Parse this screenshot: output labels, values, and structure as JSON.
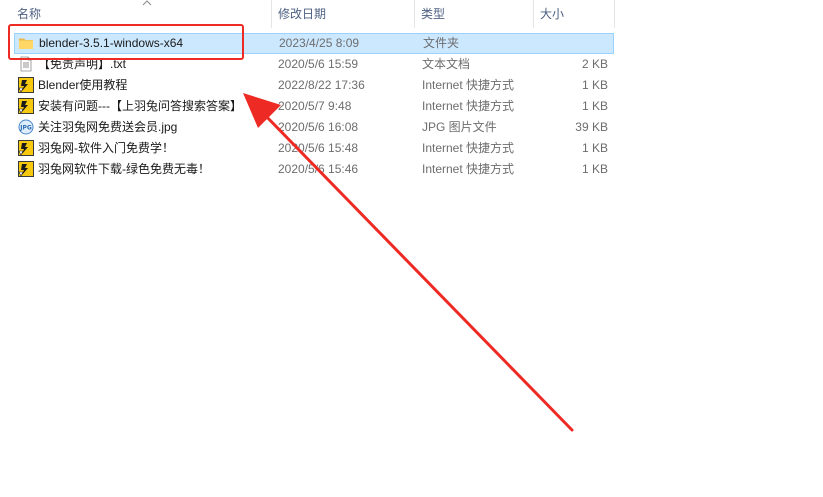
{
  "columns": {
    "name": "名称",
    "date": "修改日期",
    "type": "类型",
    "size": "大小"
  },
  "files": [
    {
      "name": "blender-3.5.1-windows-x64",
      "date": "2023/4/25 8:09",
      "type": "文件夹",
      "size": "",
      "icon": "folder-icon",
      "selected": true
    },
    {
      "name": "【免责声明】.txt",
      "date": "2020/5/6 15:59",
      "type": "文本文档",
      "size": "2 KB",
      "icon": "text-file-icon",
      "selected": false
    },
    {
      "name": "Blender使用教程",
      "date": "2022/8/22 17:36",
      "type": "Internet 快捷方式",
      "size": "1 KB",
      "icon": "internet-shortcut-icon",
      "selected": false
    },
    {
      "name": "安装有问题---【上羽兔问答搜索答案】",
      "date": "2020/5/7 9:48",
      "type": "Internet 快捷方式",
      "size": "1 KB",
      "icon": "internet-shortcut-icon",
      "selected": false
    },
    {
      "name": "关注羽兔网免费送会员.jpg",
      "date": "2020/5/6 16:08",
      "type": "JPG 图片文件",
      "size": "39 KB",
      "icon": "jpg-image-icon",
      "selected": false
    },
    {
      "name": "羽兔网-软件入门免费学！",
      "date": "2020/5/6 15:48",
      "type": "Internet 快捷方式",
      "size": "1 KB",
      "icon": "internet-shortcut-icon",
      "selected": false
    },
    {
      "name": "羽兔网软件下载-绿色免费无毒！",
      "date": "2020/5/6 15:46",
      "type": "Internet 快捷方式",
      "size": "1 KB",
      "icon": "internet-shortcut-icon",
      "selected": false
    }
  ],
  "annotation": {
    "color": "#ee2a24"
  }
}
